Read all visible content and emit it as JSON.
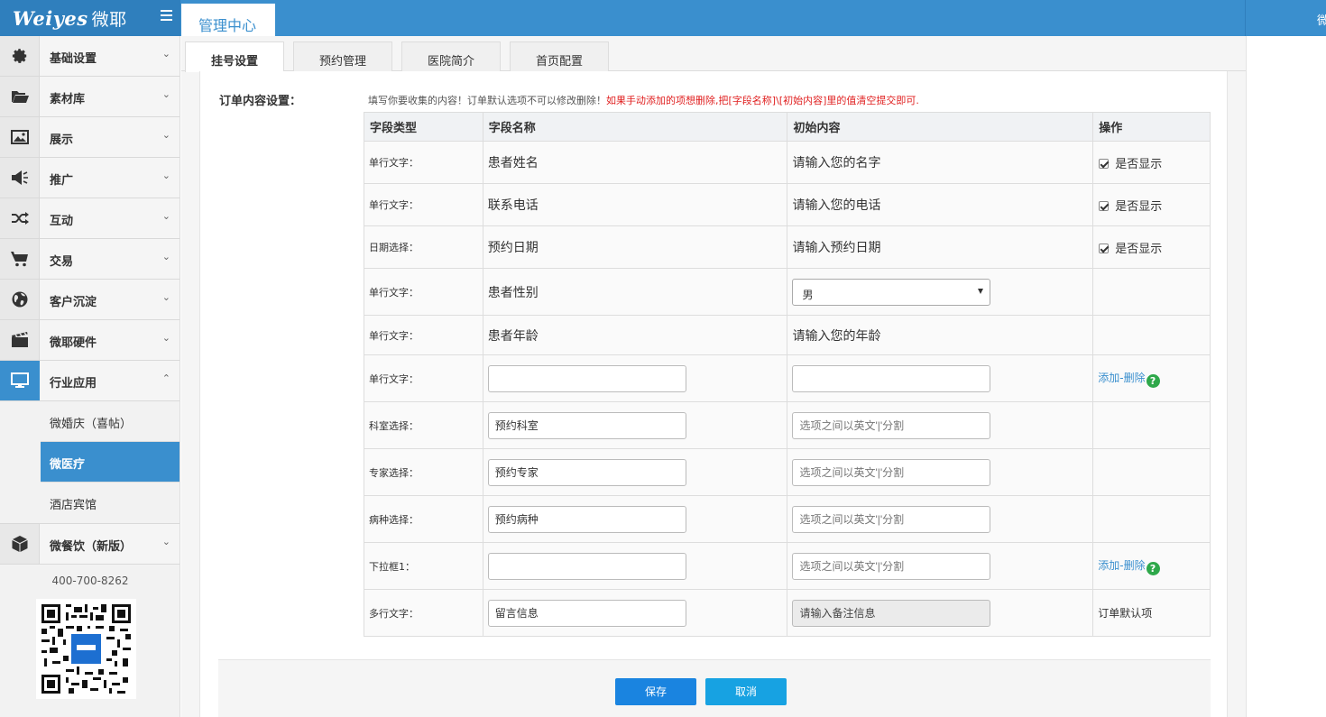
{
  "app": {
    "logo_text": "Weiyes",
    "logo_cn": "微耶",
    "top_tab": "管理中心",
    "top_right_text": "微"
  },
  "sidebar": {
    "items": [
      {
        "label": "基础设置"
      },
      {
        "label": "素材库"
      },
      {
        "label": "展示"
      },
      {
        "label": "推广"
      },
      {
        "label": "互动"
      },
      {
        "label": "交易"
      },
      {
        "label": "客户沉淀"
      },
      {
        "label": "微耶硬件"
      },
      {
        "label": "行业应用"
      },
      {
        "label": "微餐饮（新版）"
      }
    ],
    "sub_items": [
      {
        "label": "微婚庆（喜帖）"
      },
      {
        "label": "微医疗"
      },
      {
        "label": "酒店宾馆"
      }
    ],
    "phone": "400-700-8262"
  },
  "tabs": [
    {
      "label": "挂号设置"
    },
    {
      "label": "预约管理"
    },
    {
      "label": "医院简介"
    },
    {
      "label": "首页配置"
    }
  ],
  "form": {
    "section_label": "订单内容设置：",
    "hint_normal": "填写你要收集的内容！订单默认选项不可以修改删除！",
    "hint_red": "如果手动添加的项想删除,把[字段名称]\\[初始内容]里的值清空提交即可.",
    "headers": {
      "type": "字段类型",
      "name": "字段名称",
      "init": "初始内容",
      "op": "操作"
    },
    "rows": [
      {
        "type": "单行文字：",
        "name": "患者姓名",
        "init": "请输入您的名字",
        "op": "是否显示"
      },
      {
        "type": "单行文字：",
        "name": "联系电话",
        "init": "请输入您的电话",
        "op": "是否显示"
      },
      {
        "type": "日期选择：",
        "name": "预约日期",
        "init": "请输入预约日期",
        "op": "是否显示"
      },
      {
        "type": "单行文字：",
        "name": "患者性别",
        "init": "男",
        "op": ""
      },
      {
        "type": "单行文字：",
        "name": "患者年龄",
        "init": "请输入您的年龄",
        "op": ""
      },
      {
        "type": "单行文字：",
        "name": "",
        "init": "",
        "op_add": "添加",
        "op_sep": "-",
        "op_del": "删除"
      },
      {
        "type": "科室选择：",
        "name": "预约科室",
        "init_placeholder": "选项之间以英文'|'分割"
      },
      {
        "type": "专家选择：",
        "name": "预约专家",
        "init_placeholder": "选项之间以英文'|'分割"
      },
      {
        "type": "病种选择：",
        "name": "预约病种",
        "init_placeholder": "选项之间以英文'|'分割"
      },
      {
        "type": "下拉框1：",
        "name": "",
        "init_placeholder": "选项之间以英文'|'分割",
        "op_add": "添加",
        "op_sep": "-",
        "op_del": "删除"
      },
      {
        "type": "多行文字：",
        "name": "留言信息",
        "init": "请输入备注信息",
        "op": "订单默认项"
      }
    ]
  },
  "buttons": {
    "save": "保存",
    "cancel": "取消"
  },
  "colors": {
    "primary": "#3a8fce",
    "save": "#1a84e0",
    "cancel": "#17a2e2",
    "warning_text": "#e02020",
    "help_icon": "#2ea84a"
  }
}
